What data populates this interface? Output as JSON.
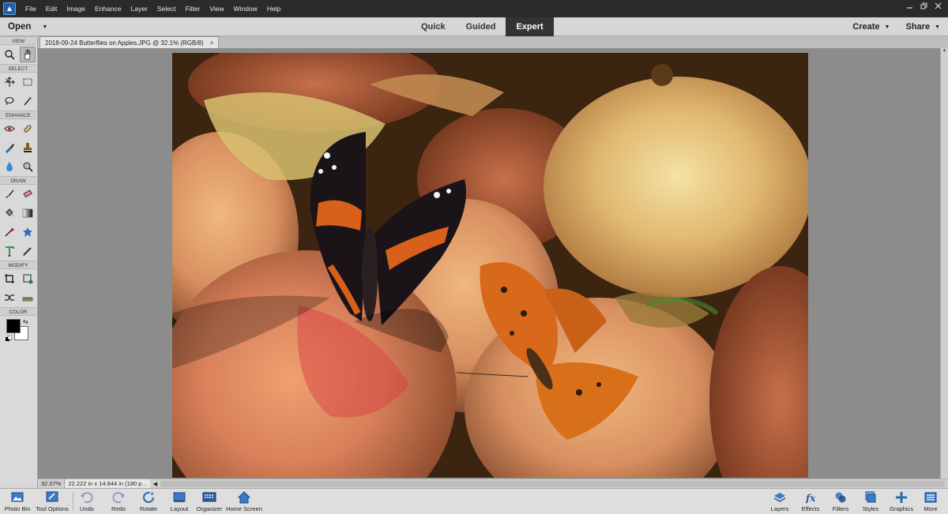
{
  "menubar": {
    "items": [
      "File",
      "Edit",
      "Image",
      "Enhance",
      "Layer",
      "Select",
      "Filter",
      "View",
      "Window",
      "Help"
    ]
  },
  "modebar": {
    "open_label": "Open",
    "modes": [
      "Quick",
      "Guided",
      "Expert"
    ],
    "active_mode": "Expert",
    "create_label": "Create",
    "share_label": "Share"
  },
  "document": {
    "tab_title": "2018-09-24 Butterflies on Apples.JPG @ 32.1% (RGB/8)",
    "close_glyph": "×"
  },
  "toolpanel": {
    "sections": {
      "view": "VIEW",
      "select": "SELECT",
      "enhance": "ENHANCE",
      "draw": "DRAW",
      "modify": "MODIFY",
      "color": "COLOR"
    },
    "foreground_color": "#000000",
    "background_color": "#ffffff"
  },
  "status": {
    "zoom": "32.07%",
    "doc_size": "22.222 in x 14.844 in (180 p..."
  },
  "bottombar": {
    "photo_bin": "Photo Bin",
    "tool_options": "Tool Options",
    "undo": "Undo",
    "redo": "Redo",
    "rotate": "Rotate",
    "layout": "Layout",
    "organizer": "Organizer",
    "home_screen": "Home Screen",
    "layers": "Layers",
    "effects": "Effects",
    "filters": "Filters",
    "styles": "Styles",
    "graphics": "Graphics",
    "more": "More"
  },
  "colors": {
    "accent_blue": "#1f5fa8",
    "active_tab_bg": "#333333"
  }
}
